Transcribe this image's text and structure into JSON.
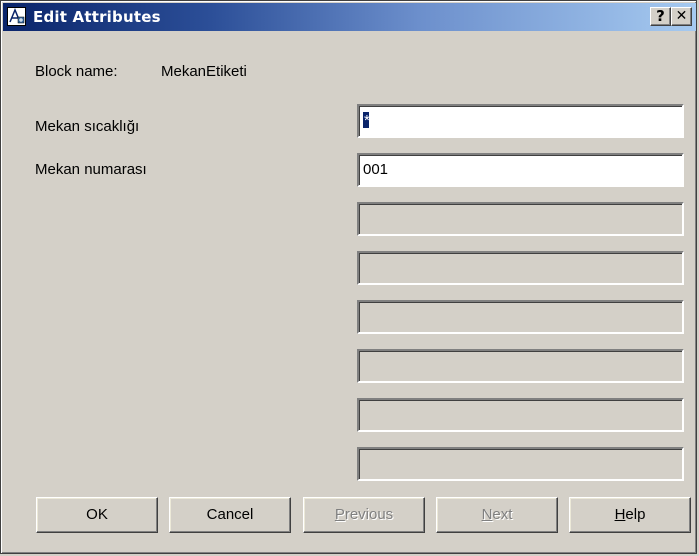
{
  "window": {
    "title": "Edit Attributes",
    "help_glyph": "?",
    "close_glyph": "✕"
  },
  "block": {
    "label": "Block name:",
    "value": "MekanEtiketi"
  },
  "attributes": [
    {
      "label": "Mekan sıcaklığı",
      "value": "",
      "selected_placeholder": "*",
      "enabled": true
    },
    {
      "label": "Mekan numarası",
      "value": "001",
      "enabled": true
    },
    {
      "label": "",
      "value": "",
      "enabled": false
    },
    {
      "label": "",
      "value": "",
      "enabled": false
    },
    {
      "label": "",
      "value": "",
      "enabled": false
    },
    {
      "label": "",
      "value": "",
      "enabled": false
    },
    {
      "label": "",
      "value": "",
      "enabled": false
    },
    {
      "label": "",
      "value": "",
      "enabled": false
    }
  ],
  "buttons": {
    "ok": {
      "label": "OK",
      "enabled": true
    },
    "cancel": {
      "label": "Cancel",
      "enabled": true
    },
    "previous": {
      "label_first": "P",
      "label_rest": "revious",
      "enabled": false
    },
    "next": {
      "label_first": "N",
      "label_rest": "ext",
      "enabled": false
    },
    "help": {
      "label_first": "H",
      "label_rest": "elp",
      "enabled": true
    }
  }
}
